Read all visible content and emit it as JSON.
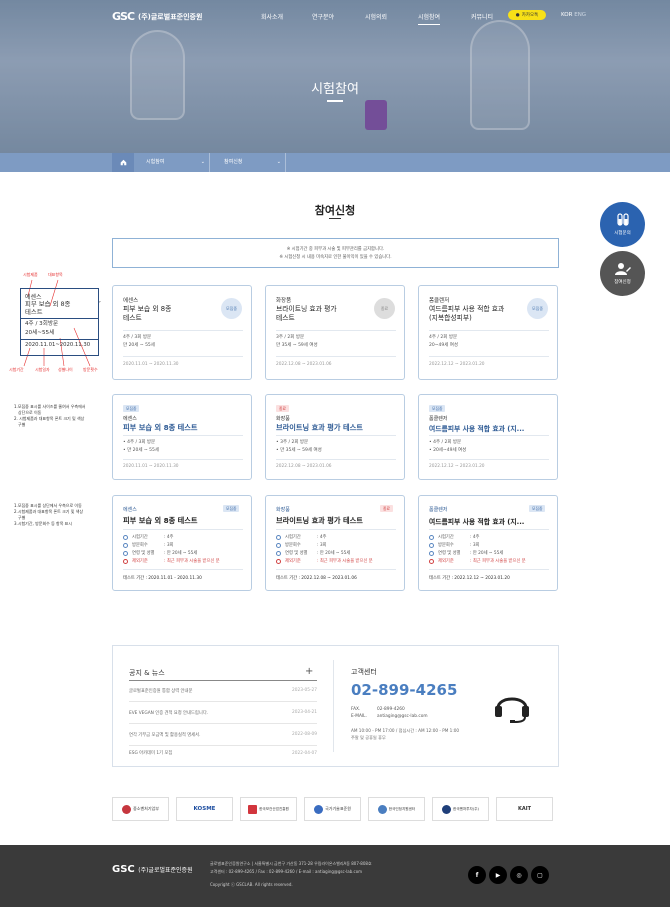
{
  "header": {
    "logo_mark": "GSC",
    "logo_name": "(주)글로벌표준인증원",
    "nav": [
      "회사소개",
      "연구분야",
      "시험의뢰",
      "시험참여",
      "커뮤니티"
    ],
    "kakao_label": "카카오톡",
    "lang_kor": "KOR",
    "lang_eng": "ENG"
  },
  "hero": {
    "title": "시험참여"
  },
  "breadcrumb": {
    "level1": "시험참여",
    "level2": "참여신청"
  },
  "section": {
    "title": "참여신청",
    "notice_line1": "※ 시험기간 중 피부과 시술 및 피부관리를 금지합니다.",
    "notice_line2": "※ 시험신청 시 내용 미숙지로 인한 불이익이 있을 수 있습니다."
  },
  "floating": {
    "btn1": "시험문의",
    "btn2": "참여신청"
  },
  "annotations": {
    "a1": "시험제품",
    "a2": "대표항목",
    "a3": "시험기간",
    "a4": "시험일자",
    "a5": "성별나이",
    "a6": "방문횟수",
    "sample": {
      "cat": "에센스",
      "title1": "피부 보습 외 8종",
      "title2": "테스트",
      "line1": "4주 / 3회방문",
      "line2": "20세~55세",
      "date": "2020.11.01~2020.11.30"
    },
    "note1": [
      "1.모집중 표시를 사이즈를 줄여서 우측에서",
      "상단으로 이동",
      "2. 시험제품과 대표항목 폰트 크기 및 색상",
      "구별"
    ],
    "note2": [
      "1.모집중 표시를 상단에서 우측으로 이동",
      "2.시험제품과 대표항목 폰트 크기 및 색상",
      "구별",
      "3.시험기간, 방문회수 등 항목 표시"
    ]
  },
  "row1": [
    {
      "cat": "에센스",
      "t1": "피부 보습 외 8종",
      "t2": "테스트",
      "badge": "모집중",
      "m1": "4주 / 3회 방문",
      "m2": "만 20세 ~ 55세",
      "date": "2020.11.01 ~ 2020.11.30"
    },
    {
      "cat": "화장품",
      "t1": "브라이트닝 효과 평가",
      "t2": "테스트",
      "badge": "종료",
      "m1": "3주 / 2회 방문",
      "m2": "만 35세 ~ 59세 여성",
      "date": "2022.12.08 ~ 2023.01.06"
    },
    {
      "cat": "폼클렌저",
      "t1": "여드름피부 사용 적합 효과",
      "t2": "(지복합성피부)",
      "badge": "모집중",
      "m1": "4주 / 2회 방문",
      "m2": "20~49세 여성",
      "date": "2022.12.12 ~ 2023.01.20"
    }
  ],
  "row2": [
    {
      "tag": "모집중",
      "cat": "에센스",
      "title": "피부 보습 외 8종 테스트",
      "m1": "• 4주 / 3회 방문",
      "m2": "• 만 20세 ~ 55세",
      "date": "2020.11.01 ~ 2020.11.30"
    },
    {
      "tag": "종료",
      "cat": "화장품",
      "title": "브라이트닝 효과 평가 테스트",
      "m1": "• 3주 / 2회 방문",
      "m2": "• 만 35세 ~ 59세 여성",
      "date": "2022.12.08 ~ 2023.01.06"
    },
    {
      "tag": "모집중",
      "cat": "폼클렌저",
      "title": "여드름피부 사용 적합 효과 (지...",
      "m1": "• 4주 / 2회 방문",
      "m2": "• 20세~49세 여성",
      "date": "2022.12.12 ~ 2023.01.20"
    }
  ],
  "row3": [
    {
      "cat": "에센스",
      "tag": "모집중",
      "title": "피부 보습 외 8종 테스트",
      "r1": "시험기간",
      "v1": ": 4주",
      "r2": "방문회수",
      "v2": ": 3회",
      "r3": "연령 및 성별",
      "v3": ": 만 20세 ~ 55세",
      "r4": "제외기준",
      "v4": ": 최근 피부과 시술을 받으신 분",
      "period": "테스트 기간 : 2020.11.01 - 2020.11.30"
    },
    {
      "cat": "화장품",
      "tag": "종료",
      "title": "브라이트닝 효과 평가 테스트",
      "r1": "시험기간",
      "v1": ": 4주",
      "r2": "방문회수",
      "v2": ": 3회",
      "r3": "연령 및 성별",
      "v3": ": 만 20세 ~ 55세",
      "r4": "제외기준",
      "v4": ": 최근 피부과 시술을 받으신 분",
      "period": "테스트 기간 : 2022.12.08 ~ 2023.01.06"
    },
    {
      "cat": "폼클렌저",
      "tag": "모집중",
      "title": "여드름피부 사용 적합 효과 (지...",
      "r1": "시험기간",
      "v1": ": 4주",
      "r2": "방문회수",
      "v2": ": 3회",
      "r3": "연령 및 성별",
      "v3": ": 만 20세 ~ 55세",
      "r4": "제외기준",
      "v4": ": 최근 피부과 시술을 받으신 분",
      "period": "테스트 기간 : 2022.12.12 ~ 2023.01.20"
    }
  ],
  "news": {
    "title": "공지 & 뉴스",
    "plus": "+",
    "items": [
      {
        "text": "글로벌표준인증원 통합 상력 안내문",
        "date": "2023-05-27"
      },
      {
        "text": "EVE VEGAN 인증 견적 요청 안내드립니다.",
        "date": "2023-04-21"
      },
      {
        "text": "연각 기부금 모금액 및 활용실적 명세서.",
        "date": "2022-08-09"
      },
      {
        "text": "ESG 아카데미 1기 모집",
        "date": "2022-04-07"
      }
    ]
  },
  "cs": {
    "title": "고객센터",
    "phone": "02-899-4265",
    "fax_label": "FAX.",
    "fax": "02-899-4260",
    "email_label": "E-MAIL.",
    "email": "antiaging@gsc-lab.com",
    "hours": "AM 10:00 - PM 17:00 / 점심시간 : AM 12:00 - PM 1:00",
    "closed": "주말 및 공휴일 휴무"
  },
  "partners": [
    "중소벤처기업부",
    "KOSME",
    "한국보건산업진흥원",
    "국가기술표준원",
    "한국인정지원센터",
    "한국벤처투자(주)",
    "KAIT"
  ],
  "footer": {
    "logo_mark": "GSC",
    "logo_name": "(주)글로벌표준인증원",
    "line1": "글로벌표준인증원연구소  |  서울특별시 금천구 가산동 371-28 우림라이온스밸리A동 807-808호",
    "line2": "고객센터 : 02-899-4265 / Fax : 02-899-4260 / E-mail : antiaging@gsc-lab.com",
    "line3": "Copyright ⓒ GSCLAB. All rights reserved."
  },
  "colors": {
    "accent": "#3b6fb6",
    "hero": "#8da2b8",
    "breadcrumb": "#7e9bc3",
    "footer": "#3a3a3a"
  }
}
